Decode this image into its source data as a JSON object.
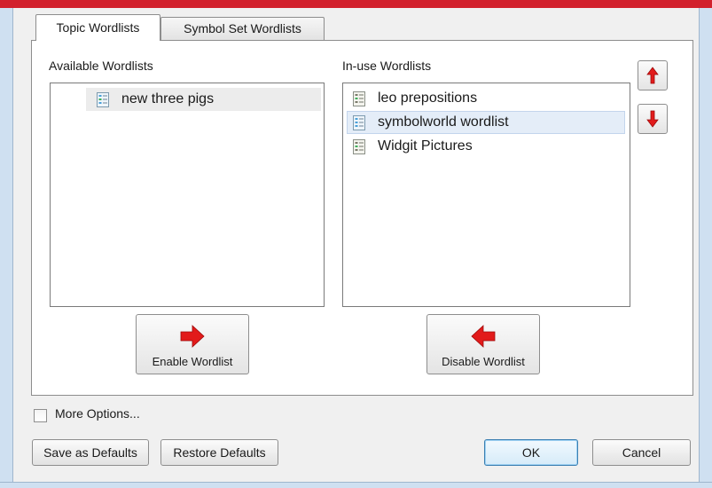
{
  "tabs": [
    "Topic Wordlists",
    "Symbol Set Wordlists"
  ],
  "available": {
    "label": "Available Wordlists",
    "items": [
      "new three pigs"
    ]
  },
  "inuse": {
    "label": "In-use Wordlists",
    "items": [
      "leo prepositions",
      "symbolworld wordlist",
      "Widgit Pictures"
    ],
    "selected_item": "symbolworld wordlist"
  },
  "buttons": {
    "enable": "Enable Wordlist",
    "disable": "Disable Wordlist",
    "save_defaults": "Save as Defaults",
    "restore_defaults": "Restore Defaults",
    "ok": "OK",
    "cancel": "Cancel"
  },
  "more_options": {
    "label": "More Options...",
    "checked": false
  },
  "colors": {
    "accent_red": "#d2202c",
    "arrow_red": "#e21b1b",
    "selection": "#e4edf8"
  },
  "icons": [
    "wordlist-icon",
    "arrow-right-icon",
    "arrow-left-icon",
    "arrow-up-icon",
    "arrow-down-icon"
  ]
}
